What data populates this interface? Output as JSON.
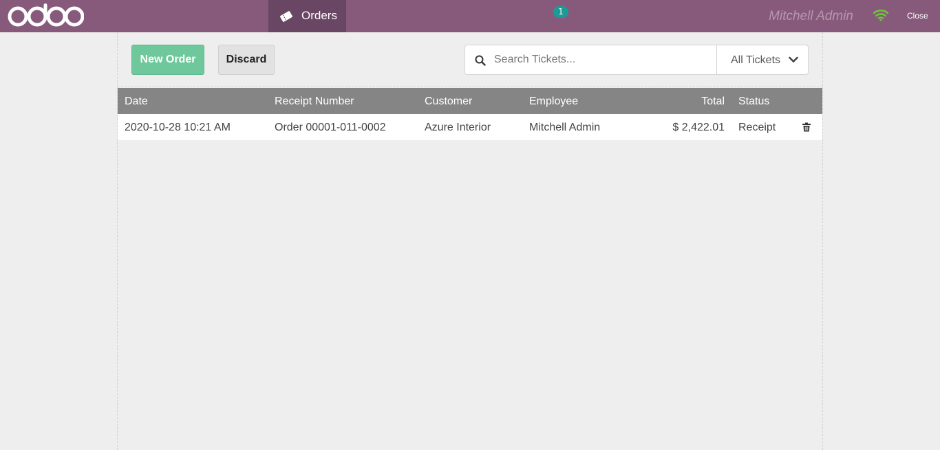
{
  "topbar": {
    "logo_text": "odoo",
    "orders_tab": {
      "label": "Orders",
      "badge_count": "1"
    },
    "user_name": "Mitchell Admin",
    "close_label": "Close",
    "colors": {
      "bar": "#875a7b",
      "tab_active": "#6a4665",
      "badge": "#1c9a96",
      "wifi": "#6ec43a"
    }
  },
  "controls": {
    "new_order_label": "New Order",
    "discard_label": "Discard",
    "search": {
      "placeholder": "Search Tickets...",
      "value": ""
    },
    "filter": {
      "selected": "All Tickets"
    }
  },
  "table": {
    "headers": {
      "date": "Date",
      "receipt": "Receipt Number",
      "customer": "Customer",
      "employee": "Employee",
      "total": "Total",
      "status": "Status"
    },
    "rows": [
      {
        "date": "2020-10-28 10:21 AM",
        "receipt": "Order 00001-011-0002",
        "customer": "Azure Interior",
        "employee": "Mitchell Admin",
        "total": "$ 2,422.01",
        "status": "Receipt"
      }
    ]
  },
  "icons": [
    "logo-icon",
    "ticket-icon",
    "wifi-icon",
    "search-icon",
    "chevron-down-icon",
    "trash-icon"
  ]
}
